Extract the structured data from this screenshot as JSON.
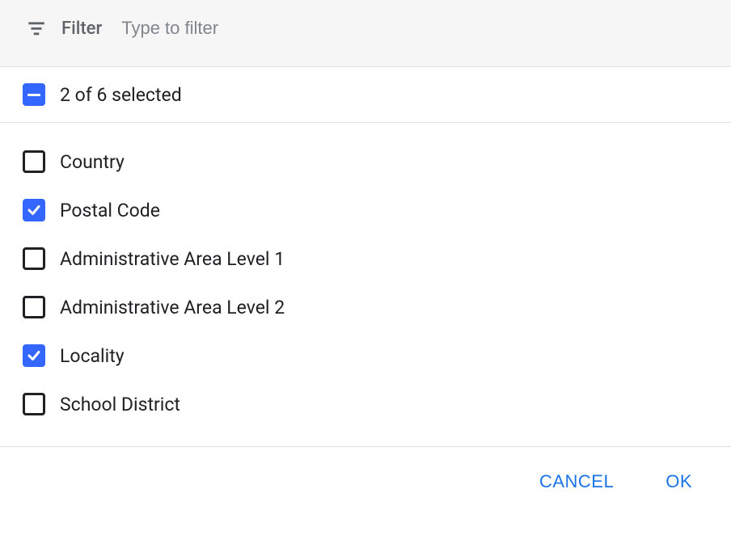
{
  "filter": {
    "label": "Filter",
    "placeholder": "Type to filter"
  },
  "summary": {
    "text": "2 of 6 selected"
  },
  "options": [
    {
      "label": "Country",
      "checked": false
    },
    {
      "label": "Postal Code",
      "checked": true
    },
    {
      "label": "Administrative Area Level 1",
      "checked": false
    },
    {
      "label": "Administrative Area Level 2",
      "checked": false
    },
    {
      "label": "Locality",
      "checked": true
    },
    {
      "label": "School District",
      "checked": false
    }
  ],
  "actions": {
    "cancel": "CANCEL",
    "ok": "OK"
  }
}
